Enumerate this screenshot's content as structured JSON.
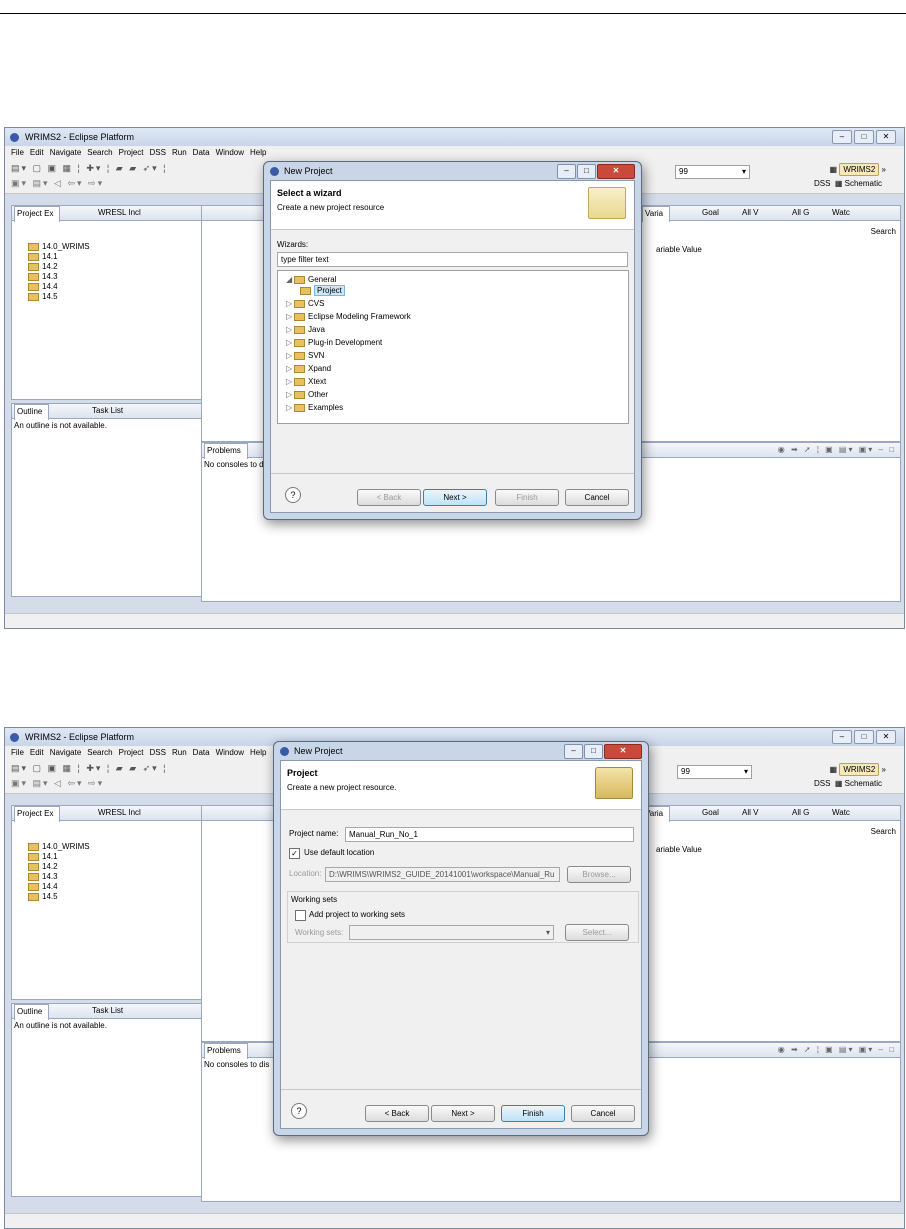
{
  "window": {
    "title": "WRIMS2 - Eclipse Platform",
    "menu": [
      "File",
      "Edit",
      "Navigate",
      "Search",
      "Project",
      "DSS",
      "Run",
      "Data",
      "Window",
      "Help"
    ],
    "combo_value": "99",
    "perspective": "WRIMS2",
    "dss_label": "DSS",
    "schematic_label": "Schematic"
  },
  "left_panel": {
    "tabs": [
      "Project Ex",
      "WRESL Incl"
    ],
    "projects": [
      "14.0_WRIMS",
      "14.1",
      "14.2",
      "14.3",
      "14.4",
      "14.5"
    ],
    "outline_tabs": [
      "Outline",
      "Task List"
    ],
    "outline_message": "An outline is not available."
  },
  "right_panel": {
    "tabs": [
      "Varia",
      "Goal",
      "All V",
      "All G",
      "Watc"
    ],
    "search_label": "Search",
    "columns": [
      "ariable",
      "Value"
    ]
  },
  "console": {
    "tab": "Problems",
    "message_short": "No consoles to d",
    "message_long": "No consoles to dis"
  },
  "dialog1": {
    "title": "New Project",
    "heading": "Select a wizard",
    "subheading": "Create a new project resource",
    "wizards_label": "Wizards:",
    "filter_value": "type filter text",
    "tree": [
      {
        "label": "General",
        "expanded": true
      },
      {
        "label": "Project",
        "child": true,
        "selected": true
      },
      {
        "label": "CVS"
      },
      {
        "label": "Eclipse Modeling Framework"
      },
      {
        "label": "Java"
      },
      {
        "label": "Plug-in Development"
      },
      {
        "label": "SVN"
      },
      {
        "label": "Xpand"
      },
      {
        "label": "Xtext"
      },
      {
        "label": "Other"
      },
      {
        "label": "Examples"
      }
    ],
    "buttons": {
      "help": "?",
      "back": "< Back",
      "next": "Next >",
      "finish": "Finish",
      "cancel": "Cancel"
    }
  },
  "dialog2": {
    "title": "New Project",
    "heading": "Project",
    "subheading": "Create a new project resource.",
    "project_name_label": "Project name:",
    "project_name_value": "Manual_Run_No_1",
    "use_default_label": "Use default location",
    "location_label": "Location:",
    "location_value": "D:\\WRIMS\\WRIMS2_GUIDE_20141001\\workspace\\Manual_Ru",
    "browse_label": "Browse...",
    "working_sets_group": "Working sets",
    "add_working_sets_label": "Add project to working sets",
    "working_sets_label": "Working sets:",
    "select_label": "Select...",
    "buttons": {
      "help": "?",
      "back": "< Back",
      "next": "Next >",
      "finish": "Finish",
      "cancel": "Cancel"
    }
  }
}
